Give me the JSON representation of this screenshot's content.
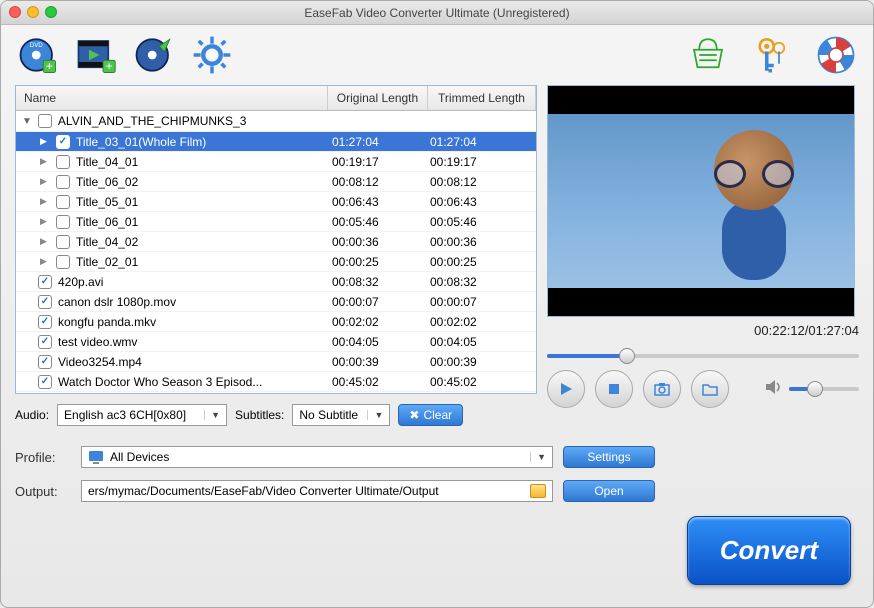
{
  "title": "EaseFab Video Converter Ultimate (Unregistered)",
  "columns": {
    "name": "Name",
    "orig": "Original Length",
    "trim": "Trimmed Length"
  },
  "group": {
    "name": "ALVIN_AND_THE_CHIPMUNKS_3"
  },
  "rows": [
    {
      "lvl": 1,
      "arrow": true,
      "checked": true,
      "sel": true,
      "name": "Title_03_01(Whole Film)",
      "orig": "01:27:04",
      "trim": "01:27:04"
    },
    {
      "lvl": 1,
      "arrow": true,
      "checked": false,
      "sel": false,
      "name": "Title_04_01",
      "orig": "00:19:17",
      "trim": "00:19:17"
    },
    {
      "lvl": 1,
      "arrow": true,
      "checked": false,
      "sel": false,
      "name": "Title_06_02",
      "orig": "00:08:12",
      "trim": "00:08:12"
    },
    {
      "lvl": 1,
      "arrow": true,
      "checked": false,
      "sel": false,
      "name": "Title_05_01",
      "orig": "00:06:43",
      "trim": "00:06:43"
    },
    {
      "lvl": 1,
      "arrow": true,
      "checked": false,
      "sel": false,
      "name": "Title_06_01",
      "orig": "00:05:46",
      "trim": "00:05:46"
    },
    {
      "lvl": 1,
      "arrow": true,
      "checked": false,
      "sel": false,
      "name": "Title_04_02",
      "orig": "00:00:36",
      "trim": "00:00:36"
    },
    {
      "lvl": 1,
      "arrow": true,
      "checked": false,
      "sel": false,
      "name": "Title_02_01",
      "orig": "00:00:25",
      "trim": "00:00:25"
    },
    {
      "lvl": 0,
      "arrow": false,
      "checked": true,
      "sel": false,
      "name": "420p.avi",
      "orig": "00:08:32",
      "trim": "00:08:32"
    },
    {
      "lvl": 0,
      "arrow": false,
      "checked": true,
      "sel": false,
      "name": "canon dslr 1080p.mov",
      "orig": "00:00:07",
      "trim": "00:00:07"
    },
    {
      "lvl": 0,
      "arrow": false,
      "checked": true,
      "sel": false,
      "name": "kongfu panda.mkv",
      "orig": "00:02:02",
      "trim": "00:02:02"
    },
    {
      "lvl": 0,
      "arrow": false,
      "checked": true,
      "sel": false,
      "name": "test video.wmv",
      "orig": "00:04:05",
      "trim": "00:04:05"
    },
    {
      "lvl": 0,
      "arrow": false,
      "checked": true,
      "sel": false,
      "name": "Video3254.mp4",
      "orig": "00:00:39",
      "trim": "00:00:39"
    },
    {
      "lvl": 0,
      "arrow": false,
      "checked": true,
      "sel": false,
      "name": "Watch Doctor Who Season 3 Episod...",
      "orig": "00:45:02",
      "trim": "00:45:02"
    }
  ],
  "audio": {
    "label": "Audio:",
    "value": "English ac3 6CH[0x80]"
  },
  "subtitles": {
    "label": "Subtitles:",
    "value": "No Subtitle"
  },
  "clear": "Clear",
  "timecode": "00:22:12/01:27:04",
  "progress_pct": 25.5,
  "profile": {
    "label": "Profile:",
    "value": "All Devices"
  },
  "output": {
    "label": "Output:",
    "value": "ers/mymac/Documents/EaseFab/Video Converter Ultimate/Output"
  },
  "buttons": {
    "settings": "Settings",
    "open": "Open",
    "convert": "Convert"
  }
}
